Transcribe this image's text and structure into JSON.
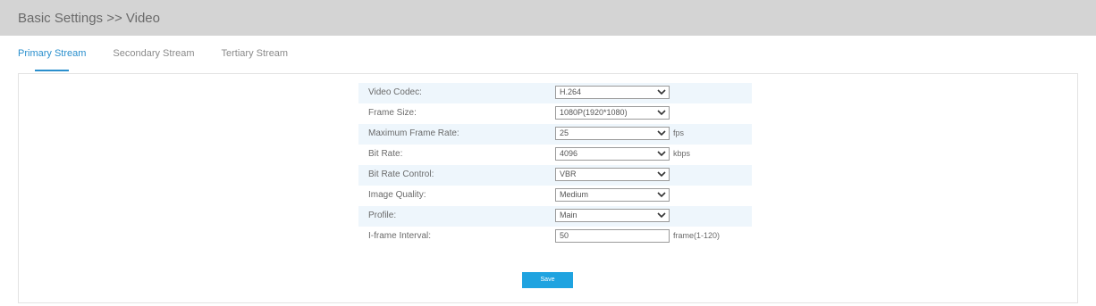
{
  "header": {
    "title": "Basic Settings >> Video"
  },
  "tabs": [
    {
      "label": "Primary Stream",
      "active": true
    },
    {
      "label": "Secondary Stream",
      "active": false
    },
    {
      "label": "Tertiary Stream",
      "active": false
    }
  ],
  "form": {
    "video_codec": {
      "label": "Video Codec:",
      "value": "H.264"
    },
    "frame_size": {
      "label": "Frame Size:",
      "value": "1080P(1920*1080)"
    },
    "max_frame_rate": {
      "label": "Maximum Frame Rate:",
      "value": "25",
      "unit": "fps"
    },
    "bit_rate": {
      "label": "Bit Rate:",
      "value": "4096",
      "unit": "kbps"
    },
    "bit_rate_control": {
      "label": "Bit Rate Control:",
      "value": "VBR"
    },
    "image_quality": {
      "label": "Image Quality:",
      "value": "Medium"
    },
    "profile": {
      "label": "Profile:",
      "value": "Main"
    },
    "iframe_interval": {
      "label": "I-frame Interval:",
      "value": "50",
      "unit": "frame(1-120)"
    }
  },
  "buttons": {
    "save": "Save"
  },
  "colors": {
    "accent": "#2a8fcd",
    "button": "#1fa3e0",
    "header_bg": "#d4d4d4",
    "row_alt": "#eef6fc"
  }
}
